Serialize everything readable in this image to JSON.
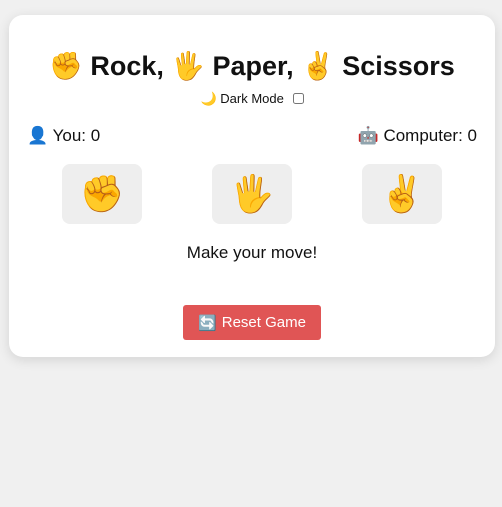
{
  "title": {
    "rock_emoji": "✊",
    "rock": "Rock,",
    "paper_emoji": "🖐",
    "paper": "Paper,",
    "scissors_emoji": "✌️",
    "scissors": "Scissors"
  },
  "dark_mode": {
    "icon": "🌙",
    "label": "Dark Mode",
    "checked": false
  },
  "score": {
    "you_icon": "👤",
    "you_label": "You: 0",
    "computer_icon": "🤖",
    "computer_label": "Computer: 0"
  },
  "choices": [
    {
      "name": "rock",
      "emoji": "✊"
    },
    {
      "name": "paper",
      "emoji": "🖐"
    },
    {
      "name": "scissors",
      "emoji": "✌️"
    }
  ],
  "status": "Make your move!",
  "reset": {
    "icon": "🔄",
    "label": "Reset Game"
  },
  "colors": {
    "background": "#f0f0f0",
    "card": "#ffffff",
    "choice_bg": "#eeeeee",
    "reset_bg": "#e05555"
  }
}
